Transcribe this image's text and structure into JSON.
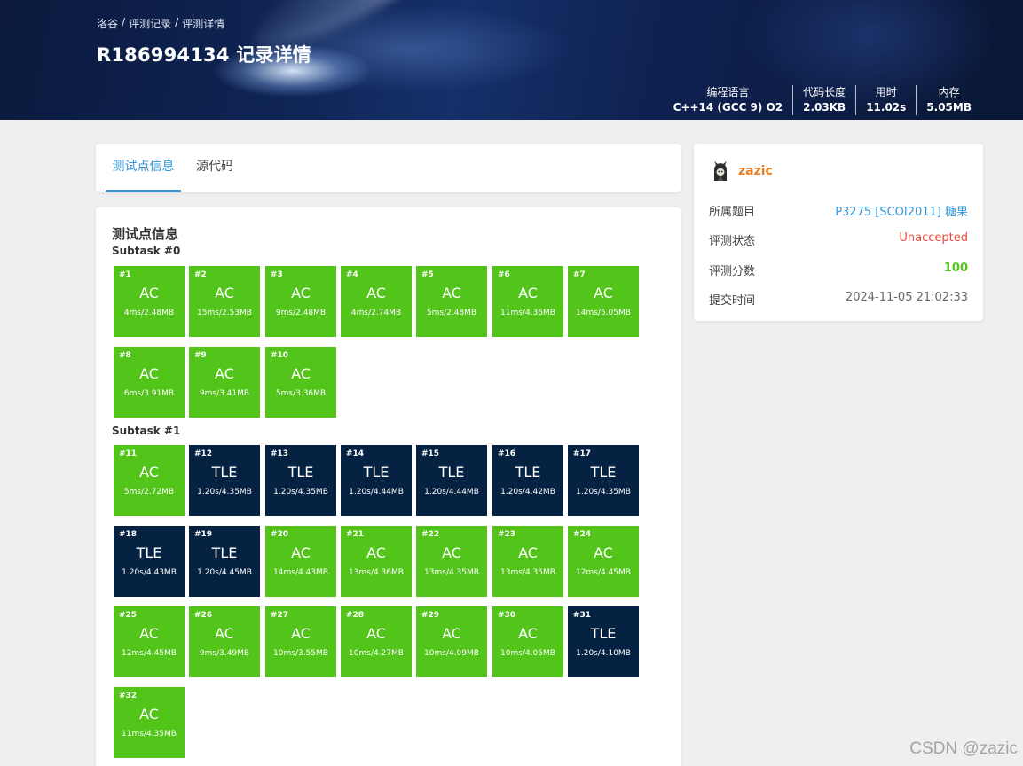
{
  "header": {
    "breadcrumb": [
      "洛谷",
      "/",
      "评测记录",
      "/",
      "评测详情"
    ],
    "title": "R186994134 记录详情",
    "stats": [
      {
        "label": "编程语言",
        "value": "C++14 (GCC 9) O2"
      },
      {
        "label": "代码长度",
        "value": "2.03KB"
      },
      {
        "label": "用时",
        "value": "11.02s"
      },
      {
        "label": "内存",
        "value": "5.05MB"
      }
    ]
  },
  "tabs": [
    {
      "label": "测试点信息",
      "active": true
    },
    {
      "label": "源代码",
      "active": false
    }
  ],
  "main": {
    "section_title": "测试点信息",
    "subtasks": [
      {
        "title": "Subtask #0",
        "cases": [
          {
            "id": "#1",
            "status": "AC",
            "usage": "4ms/2.48MB"
          },
          {
            "id": "#2",
            "status": "AC",
            "usage": "15ms/2.53MB"
          },
          {
            "id": "#3",
            "status": "AC",
            "usage": "9ms/2.48MB"
          },
          {
            "id": "#4",
            "status": "AC",
            "usage": "4ms/2.74MB"
          },
          {
            "id": "#5",
            "status": "AC",
            "usage": "5ms/2.48MB"
          },
          {
            "id": "#6",
            "status": "AC",
            "usage": "11ms/4.36MB"
          },
          {
            "id": "#7",
            "status": "AC",
            "usage": "14ms/5.05MB"
          },
          {
            "id": "#8",
            "status": "AC",
            "usage": "6ms/3.91MB"
          },
          {
            "id": "#9",
            "status": "AC",
            "usage": "9ms/3.41MB"
          },
          {
            "id": "#10",
            "status": "AC",
            "usage": "5ms/3.36MB"
          }
        ]
      },
      {
        "title": "Subtask #1",
        "cases": [
          {
            "id": "#11",
            "status": "AC",
            "usage": "5ms/2.72MB"
          },
          {
            "id": "#12",
            "status": "TLE",
            "usage": "1.20s/4.35MB"
          },
          {
            "id": "#13",
            "status": "TLE",
            "usage": "1.20s/4.35MB"
          },
          {
            "id": "#14",
            "status": "TLE",
            "usage": "1.20s/4.44MB"
          },
          {
            "id": "#15",
            "status": "TLE",
            "usage": "1.20s/4.44MB"
          },
          {
            "id": "#16",
            "status": "TLE",
            "usage": "1.20s/4.42MB"
          },
          {
            "id": "#17",
            "status": "TLE",
            "usage": "1.20s/4.35MB"
          },
          {
            "id": "#18",
            "status": "TLE",
            "usage": "1.20s/4.43MB"
          },
          {
            "id": "#19",
            "status": "TLE",
            "usage": "1.20s/4.45MB"
          },
          {
            "id": "#20",
            "status": "AC",
            "usage": "14ms/4.43MB"
          },
          {
            "id": "#21",
            "status": "AC",
            "usage": "13ms/4.36MB"
          },
          {
            "id": "#22",
            "status": "AC",
            "usage": "13ms/4.35MB"
          },
          {
            "id": "#23",
            "status": "AC",
            "usage": "13ms/4.35MB"
          },
          {
            "id": "#24",
            "status": "AC",
            "usage": "12ms/4.45MB"
          },
          {
            "id": "#25",
            "status": "AC",
            "usage": "12ms/4.45MB"
          },
          {
            "id": "#26",
            "status": "AC",
            "usage": "9ms/3.49MB"
          },
          {
            "id": "#27",
            "status": "AC",
            "usage": "10ms/3.55MB"
          },
          {
            "id": "#28",
            "status": "AC",
            "usage": "10ms/4.27MB"
          },
          {
            "id": "#29",
            "status": "AC",
            "usage": "10ms/4.09MB"
          },
          {
            "id": "#30",
            "status": "AC",
            "usage": "10ms/4.05MB"
          },
          {
            "id": "#31",
            "status": "TLE",
            "usage": "1.20s/4.10MB"
          },
          {
            "id": "#32",
            "status": "AC",
            "usage": "11ms/4.35MB"
          }
        ]
      }
    ]
  },
  "side": {
    "username": "zazic",
    "avatar_icon": "avatar-icon",
    "rows": [
      {
        "key": "所属题目",
        "value": "P3275 [SCOI2011] 糖果",
        "kind": "link"
      },
      {
        "key": "评测状态",
        "value": "Unaccepted",
        "kind": "bad"
      },
      {
        "key": "评测分数",
        "value": "100",
        "kind": "good"
      },
      {
        "key": "提交时间",
        "value": "2024-11-05 21:02:33",
        "kind": "plain"
      }
    ]
  },
  "colors": {
    "ac": "#52c41a",
    "tle": "#052242",
    "accent": "#3498db",
    "username": "#e67e22",
    "unaccepted": "#e74c3c"
  },
  "watermark": "CSDN @zazic"
}
